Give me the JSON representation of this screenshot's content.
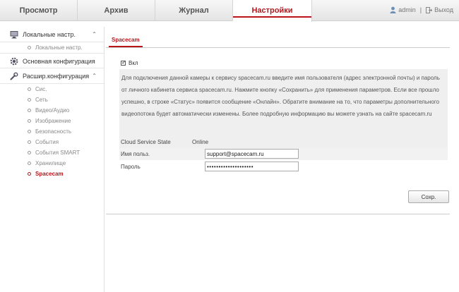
{
  "nav": {
    "tabs": [
      {
        "label": "Просмотр"
      },
      {
        "label": "Архив"
      },
      {
        "label": "Журнал"
      },
      {
        "label": "Настройки",
        "active": true
      }
    ],
    "user": "admin",
    "separator": "|",
    "logout": "Выход"
  },
  "sidebar": {
    "sections": [
      {
        "label": "Локальные настр.",
        "icon": "monitor-icon",
        "expanded": true,
        "items": [
          {
            "label": "Локальные настр."
          }
        ]
      },
      {
        "label": "Основная конфигурация",
        "icon": "gear-icon",
        "expanded": false,
        "items": []
      },
      {
        "label": "Расшир.конфигурация",
        "icon": "wrench-icon",
        "expanded": true,
        "items": [
          {
            "label": "Сис."
          },
          {
            "label": "Сеть"
          },
          {
            "label": "Видео/Аудио"
          },
          {
            "label": "Изображение"
          },
          {
            "label": "Безопасность"
          },
          {
            "label": "События"
          },
          {
            "label": "События SMART"
          },
          {
            "label": "Хранилище"
          },
          {
            "label": "Spacecam",
            "active": true
          }
        ]
      }
    ]
  },
  "main": {
    "tab": "Spacecam",
    "enable_label": "Вкл",
    "enable_checked": true,
    "description": "Для подключения данной камеры к сервису spacecam.ru введите имя пользователя (адрес электронной почты) и пароль от личного кабинета сервиса spacecam.ru. Нажмите кнопку «Сохранить» для применения параметров. Если все прошло успешно, в строке «Статус» появится сообщение «Онлайн». Обратите внимание на то, что параметры дополнительного видеопотока будет автоматически изменены. Более подробную информацию вы можете узнать на сайте spacecam.ru",
    "fields": {
      "status_label": "Cloud Service State",
      "status_value": "Online",
      "user_label": "Имя польз.",
      "user_value": "support@spacecam.ru",
      "password_label": "Пароль",
      "password_value": "••••••••••••••••••••"
    },
    "save": "Сохр."
  },
  "colors": {
    "accent": "#b8161c"
  }
}
